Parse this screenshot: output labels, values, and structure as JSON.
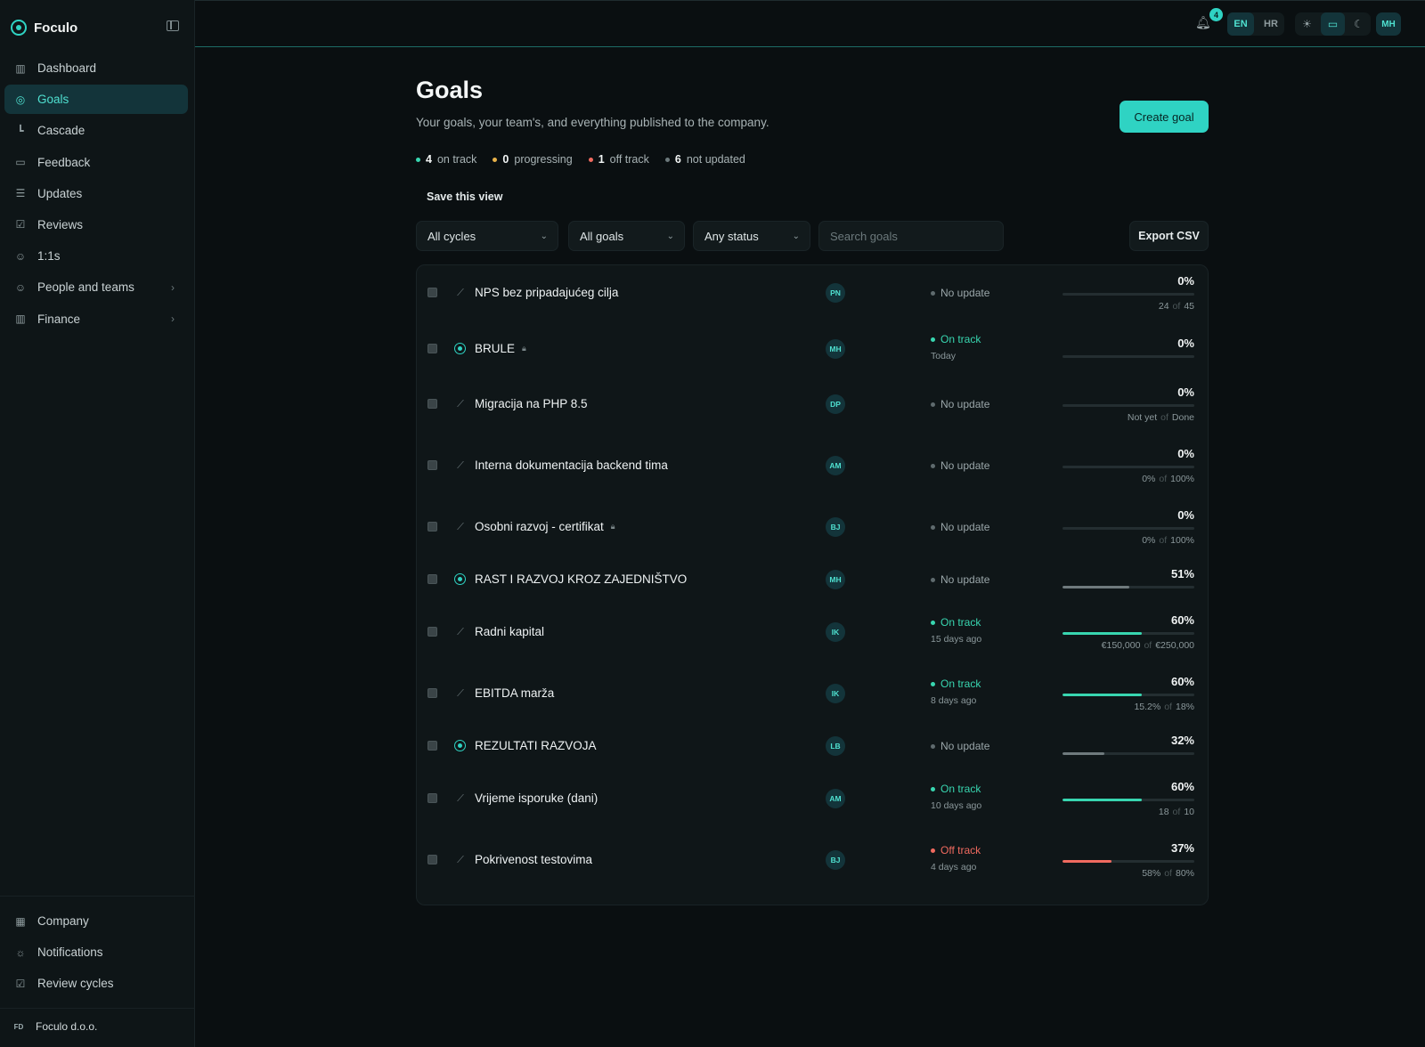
{
  "app": {
    "name": "Foculo"
  },
  "sidebar": {
    "items": [
      {
        "label": "Dashboard",
        "icon": "bar-chart-icon",
        "active": false,
        "chevron": false
      },
      {
        "label": "Goals",
        "icon": "target-icon",
        "active": true,
        "chevron": false
      },
      {
        "label": "Cascade",
        "icon": "cascade-icon",
        "active": false,
        "chevron": false
      },
      {
        "label": "Feedback",
        "icon": "message-icon",
        "active": false,
        "chevron": false
      },
      {
        "label": "Updates",
        "icon": "document-icon",
        "active": false,
        "chevron": false
      },
      {
        "label": "Reviews",
        "icon": "clipboard-check-icon",
        "active": false,
        "chevron": false
      },
      {
        "label": "1:1s",
        "icon": "users-icon",
        "active": false,
        "chevron": false
      },
      {
        "label": "People and teams",
        "icon": "people-icon",
        "active": false,
        "chevron": true
      },
      {
        "label": "Finance",
        "icon": "finance-chart-icon",
        "active": false,
        "chevron": true
      }
    ],
    "bottom_items": [
      {
        "label": "Company",
        "icon": "building-icon"
      },
      {
        "label": "Notifications",
        "icon": "bell-settings-icon"
      },
      {
        "label": "Review cycles",
        "icon": "review-cycles-icon"
      }
    ],
    "org": {
      "initials": "FD",
      "name": "Foculo d.o.o."
    }
  },
  "topbar": {
    "notification_count": "4",
    "languages": [
      {
        "code": "EN",
        "active": true
      },
      {
        "code": "HR",
        "active": false
      }
    ],
    "themes": [
      {
        "icon": "sun-icon",
        "glyph": "☀",
        "active": false
      },
      {
        "icon": "monitor-icon",
        "glyph": "▭",
        "active": true
      },
      {
        "icon": "moon-icon",
        "glyph": "☾",
        "active": false
      }
    ],
    "user_initials": "MH"
  },
  "header": {
    "title": "Goals",
    "subtitle": "Your goals, your team's, and everything published to the company.",
    "create_label": "Create goal"
  },
  "stats": [
    {
      "count": "4",
      "label": "on track",
      "color": "#38d6b0"
    },
    {
      "count": "0",
      "label": "progressing",
      "color": "#e8b24a"
    },
    {
      "count": "1",
      "label": "off track",
      "color": "#f06a5f"
    },
    {
      "count": "6",
      "label": "not updated",
      "color": "#6c797c"
    }
  ],
  "save_view_label": "Save this view",
  "filters": {
    "cycle": "All cycles",
    "goals": "All goals",
    "status": "Any status",
    "search_placeholder": "Search goals",
    "export_label": "Export CSV"
  },
  "colors": {
    "accent": "#2fd3c3",
    "on_track": "#38d6b0",
    "off_track": "#f06a5f",
    "neutral_bar": "#6f7a7d"
  },
  "goals": [
    {
      "name": "NPS bez pripadajućeg cilja",
      "type": "key-result",
      "locked": false,
      "owner": "PN",
      "status": "No update",
      "status_kind": "none",
      "when": "",
      "percent": "0%",
      "progress": 0,
      "current": "24",
      "target": "45"
    },
    {
      "name": "BRULE",
      "type": "objective",
      "locked": true,
      "owner": "MH",
      "status": "On track",
      "status_kind": "ontrack",
      "when": "Today",
      "percent": "0%",
      "progress": 0,
      "current": "",
      "target": ""
    },
    {
      "name": "Migracija na PHP 8.5",
      "type": "key-result",
      "locked": false,
      "owner": "DP",
      "status": "No update",
      "status_kind": "none",
      "when": "",
      "percent": "0%",
      "progress": 0,
      "current": "Not yet",
      "target": "Done"
    },
    {
      "name": "Interna dokumentacija backend tima",
      "type": "key-result",
      "locked": false,
      "owner": "AM",
      "status": "No update",
      "status_kind": "none",
      "when": "",
      "percent": "0%",
      "progress": 0,
      "current": "0%",
      "target": "100%"
    },
    {
      "name": "Osobni razvoj - certifikat",
      "type": "key-result",
      "locked": true,
      "owner": "BJ",
      "status": "No update",
      "status_kind": "none",
      "when": "",
      "percent": "0%",
      "progress": 0,
      "current": "0%",
      "target": "100%"
    },
    {
      "name": "RAST I RAZVOJ KROZ ZAJEDNIŠTVO",
      "type": "objective",
      "locked": false,
      "owner": "MH",
      "status": "No update",
      "status_kind": "none",
      "when": "",
      "percent": "51%",
      "progress": 51,
      "current": "",
      "target": ""
    },
    {
      "name": "Radni kapital",
      "type": "key-result",
      "locked": false,
      "owner": "IK",
      "status": "On track",
      "status_kind": "ontrack",
      "when": "15 days ago",
      "percent": "60%",
      "progress": 60,
      "current": "€150,000",
      "target": "€250,000"
    },
    {
      "name": "EBITDA marža",
      "type": "key-result",
      "locked": false,
      "owner": "IK",
      "status": "On track",
      "status_kind": "ontrack",
      "when": "8 days ago",
      "percent": "60%",
      "progress": 60,
      "current": "15.2%",
      "target": "18%"
    },
    {
      "name": "REZULTATI RAZVOJA",
      "type": "objective",
      "locked": false,
      "owner": "LB",
      "status": "No update",
      "status_kind": "none",
      "when": "",
      "percent": "32%",
      "progress": 32,
      "current": "",
      "target": ""
    },
    {
      "name": "Vrijeme isporuke (dani)",
      "type": "key-result",
      "locked": false,
      "owner": "AM",
      "status": "On track",
      "status_kind": "ontrack",
      "when": "10 days ago",
      "percent": "60%",
      "progress": 60,
      "current": "18",
      "target": "10"
    },
    {
      "name": "Pokrivenost testovima",
      "type": "key-result",
      "locked": false,
      "owner": "BJ",
      "status": "Off track",
      "status_kind": "offtrack",
      "when": "4 days ago",
      "percent": "37%",
      "progress": 37,
      "current": "58%",
      "target": "80%"
    }
  ]
}
